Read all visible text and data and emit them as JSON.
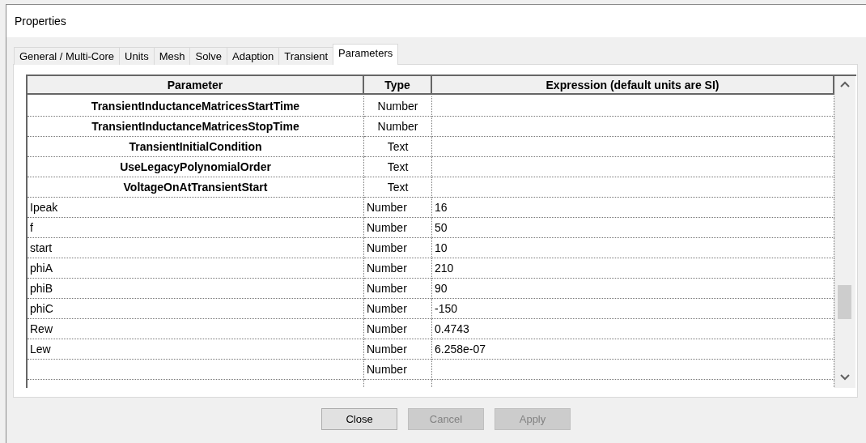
{
  "window": {
    "title": "Properties"
  },
  "tabs": [
    {
      "label": "General / Multi-Core",
      "selected": false
    },
    {
      "label": "Units",
      "selected": false
    },
    {
      "label": "Mesh",
      "selected": false
    },
    {
      "label": "Solve",
      "selected": false
    },
    {
      "label": "Adaption",
      "selected": false
    },
    {
      "label": "Transient",
      "selected": false
    },
    {
      "label": "Parameters",
      "selected": true
    }
  ],
  "table": {
    "columns": [
      "Parameter",
      "Type",
      "Expression (default units are SI)"
    ],
    "rows": [
      {
        "kind": "builtin",
        "parameter": "TransientInductanceMatricesStartTime",
        "type": "Number",
        "expression": ""
      },
      {
        "kind": "builtin",
        "parameter": "TransientInductanceMatricesStopTime",
        "type": "Number",
        "expression": ""
      },
      {
        "kind": "builtin",
        "parameter": "TransientInitialCondition",
        "type": "Text",
        "expression": ""
      },
      {
        "kind": "builtin",
        "parameter": "UseLegacyPolynomialOrder",
        "type": "Text",
        "expression": ""
      },
      {
        "kind": "builtin",
        "parameter": "VoltageOnAtTransientStart",
        "type": "Text",
        "expression": ""
      },
      {
        "kind": "user",
        "parameter": "Ipeak",
        "type": "Number",
        "expression": "16"
      },
      {
        "kind": "user",
        "parameter": "f",
        "type": "Number",
        "expression": "50"
      },
      {
        "kind": "user",
        "parameter": "start",
        "type": "Number",
        "expression": "10"
      },
      {
        "kind": "user",
        "parameter": "phiA",
        "type": "Number",
        "expression": "210"
      },
      {
        "kind": "user",
        "parameter": "phiB",
        "type": "Number",
        "expression": "90"
      },
      {
        "kind": "user",
        "parameter": "phiC",
        "type": "Number",
        "expression": "-150"
      },
      {
        "kind": "user",
        "parameter": "Rew",
        "type": "Number",
        "expression": "0.4743"
      },
      {
        "kind": "user",
        "parameter": "Lew",
        "type": "Number",
        "expression": "6.258e-07"
      },
      {
        "kind": "user",
        "parameter": "",
        "type": "Number",
        "expression": ""
      }
    ]
  },
  "buttons": [
    {
      "label": "Close",
      "disabled": false
    },
    {
      "label": "Cancel",
      "disabled": true
    },
    {
      "label": "Apply",
      "disabled": true
    }
  ]
}
